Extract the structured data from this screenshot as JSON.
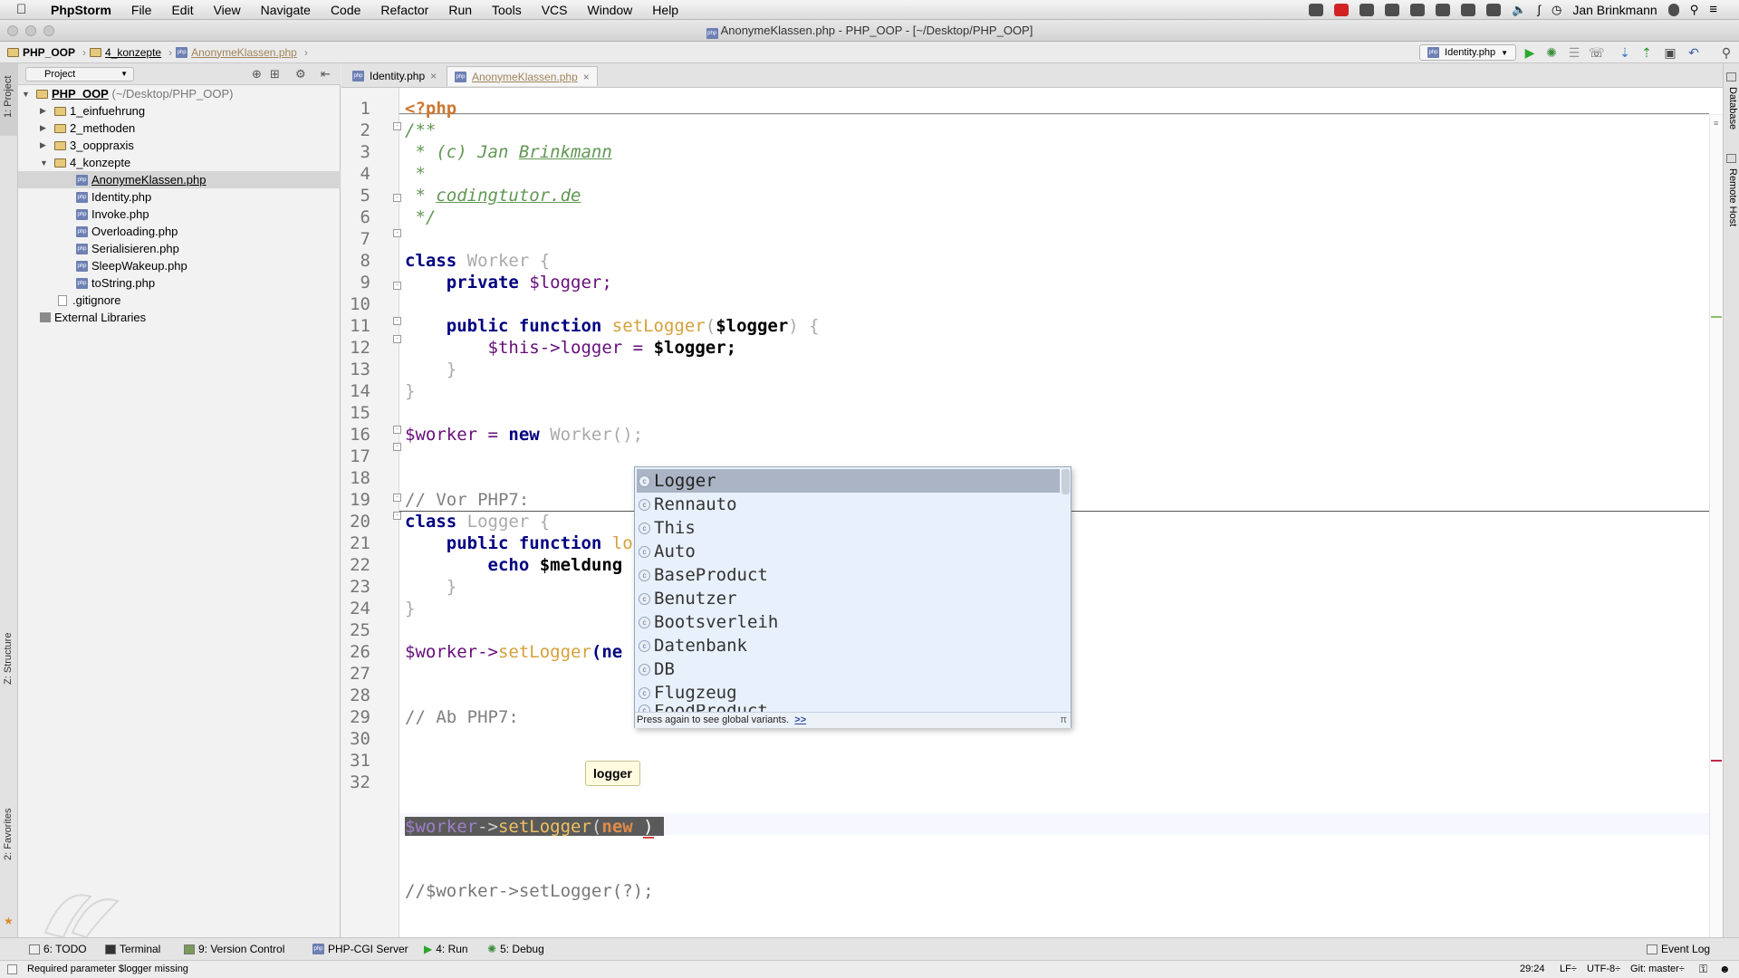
{
  "menubar": {
    "app_name": "PhpStorm",
    "items": [
      "File",
      "Edit",
      "View",
      "Navigate",
      "Code",
      "Refactor",
      "Run",
      "Tools",
      "VCS",
      "Window",
      "Help"
    ],
    "user": "Jan Brinkmann"
  },
  "window": {
    "title": "AnonymeKlassen.php - PHP_OOP - [~/Desktop/PHP_OOP]"
  },
  "navbar": {
    "crumbs": [
      "PHP_OOP",
      "4_konzepte",
      "AnonymeKlassen.php"
    ],
    "run_config": "Identity.php"
  },
  "project": {
    "selector": "Project",
    "root_name": "PHP_OOP",
    "root_path": "(~/Desktop/PHP_OOP)",
    "folders": [
      "1_einfuehrung",
      "2_methoden",
      "3_ooppraxis",
      "4_konzepte"
    ],
    "files": [
      "AnonymeKlassen.php",
      "Identity.php",
      "Invoke.php",
      "Overloading.php",
      "Serialisieren.php",
      "SleepWakeup.php",
      "toString.php"
    ],
    "gitignore": ".gitignore",
    "external": "External Libraries"
  },
  "tabs": [
    {
      "label": "Identity.php",
      "active": false
    },
    {
      "label": "AnonymeKlassen.php",
      "active": true
    }
  ],
  "editor": {
    "line_numbers": [
      "1",
      "2",
      "3",
      "4",
      "5",
      "6",
      "7",
      "8",
      "9",
      "10",
      "11",
      "12",
      "13",
      "14",
      "15",
      "16",
      "17",
      "18",
      "19",
      "20",
      "21",
      "22",
      "23",
      "24",
      "25",
      "26",
      "27",
      "28",
      "29",
      "30",
      "31",
      "32"
    ],
    "code": {
      "l1": "<?php",
      "l2": "/**",
      "l3a": " * (c) Jan ",
      "l3b": "Brinkmann",
      "l4": " *",
      "l5a": " * ",
      "l5b": "codingtutor.de",
      "l6": " */",
      "l8a": "class ",
      "l8b": "Worker {",
      "l9a": "    private ",
      "l9b": "$logger;",
      "l11a": "    public function ",
      "l11b": "setLogger",
      "l11c": "(",
      "l11d": "$logger",
      "l11e": ") {",
      "l12a": "        $this",
      "l12b": "->logger = ",
      "l12c": "$logger;",
      "l13": "    }",
      "l14": "}",
      "l16a": "$worker = ",
      "l16b": "new ",
      "l16c": "Worker();",
      "l18": "// Vor PHP7:",
      "l19a": "class ",
      "l19b": "Logger {",
      "l20a": "    public function ",
      "l20b": "lo",
      "l21a": "        echo ",
      "l21b": "$meldung",
      "l22": "    }",
      "l23": "}",
      "l25a": "$worker->",
      "l25b": "setLogger",
      "l25c": "(ne",
      "l28": "// Ab PHP7:",
      "l29a": "$worker",
      "l29b": "->",
      "l29c": "setLogger",
      "l29d": "(",
      "l29e": "new ",
      "l29f": ")",
      "l32": "//$worker->setLogger(?);"
    }
  },
  "completion": {
    "items": [
      "Logger",
      "Rennauto",
      "This",
      "Auto",
      "BaseProduct",
      "Benutzer",
      "Bootsverleih",
      "Datenbank",
      "DB",
      "Flugzeug",
      "FoodProduct"
    ],
    "hint": "Press again to see global variants.",
    "hint_link": ">>",
    "corner": "π"
  },
  "param_tooltip": "logger",
  "bottom_tabs": [
    {
      "label": "6: TODO"
    },
    {
      "label": "Terminal"
    },
    {
      "label": "9: Version Control"
    },
    {
      "label": "PHP-CGI Server"
    },
    {
      "label": "4: Run"
    },
    {
      "label": "5: Debug"
    }
  ],
  "event_log": "Event Log",
  "left_stripe": {
    "project": "1: Project",
    "structure": "Z: Structure",
    "favorites": "2: Favorites"
  },
  "right_stripe": {
    "database": "Database",
    "remote": "Remote Host"
  },
  "status": {
    "message": "Required parameter $logger missing",
    "position": "29:24",
    "line_sep": "LF÷",
    "encoding": "UTF-8÷",
    "git": "Git: master÷"
  }
}
